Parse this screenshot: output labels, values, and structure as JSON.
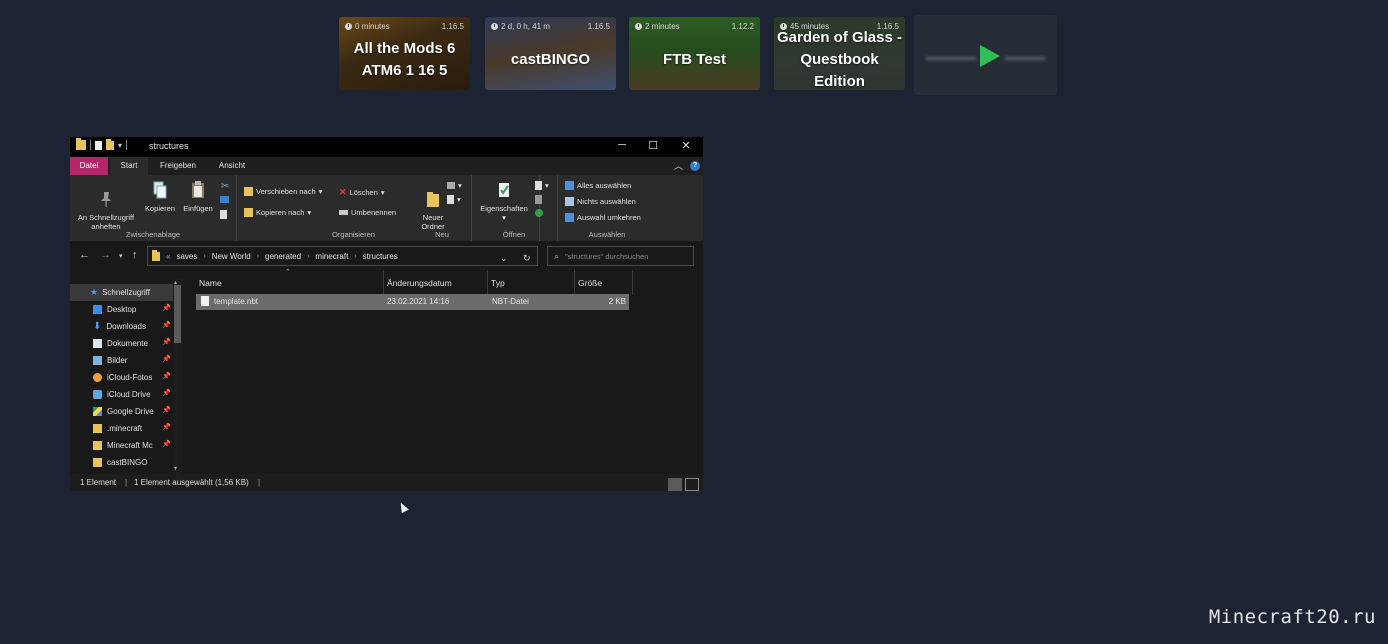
{
  "cards": [
    {
      "time": "0 minutes",
      "version": "1.16.5",
      "title": "All the Mods 6\nATM6 1 16 5"
    },
    {
      "time": "2 d, 0 h, 41 m",
      "version": "1.16.5",
      "title": "castBINGO"
    },
    {
      "time": "2 minutes",
      "version": "1.12.2",
      "title": "FTB Test"
    },
    {
      "time": "45 minutes",
      "version": "1.16.5",
      "title": "Garden of Glass -\nQuestbook Edition"
    }
  ],
  "explorer": {
    "title": "structures",
    "tabs": [
      "Datei",
      "Start",
      "Freigeben",
      "Ansicht"
    ],
    "ribbon": {
      "pin": "An Schnellzugriff\nanheften",
      "copy": "Kopieren",
      "paste": "Einfügen",
      "clipboard_group": "Zwischenablage",
      "move_to": "Verschieben nach",
      "copy_to": "Kopieren nach",
      "delete": "Löschen",
      "rename": "Umbenennen",
      "organize_group": "Organisieren",
      "new_folder": "Neuer\nOrdner",
      "new_group": "Neu",
      "properties": "Eigenschaften",
      "open_group": "Öffnen",
      "select_all": "Alles auswählen",
      "select_none": "Nichts auswählen",
      "invert_selection": "Auswahl umkehren",
      "select_group": "Auswählen"
    },
    "address": {
      "prefix": "«",
      "crumbs": [
        "saves",
        "New World",
        "generated",
        "minecraft",
        "structures"
      ],
      "search_placeholder": "\"structures\" durchsuchen"
    },
    "sidebar": [
      {
        "label": "Schnellzugriff",
        "icon": "star-icon",
        "pinned": false
      },
      {
        "label": "Desktop",
        "icon": "desktop-icon",
        "pinned": true
      },
      {
        "label": "Downloads",
        "icon": "download-icon",
        "pinned": true
      },
      {
        "label": "Dokumente",
        "icon": "document-icon",
        "pinned": true
      },
      {
        "label": "Bilder",
        "icon": "pictures-icon",
        "pinned": true
      },
      {
        "label": "iCloud-Fotos",
        "icon": "icloud-photos-icon",
        "pinned": true
      },
      {
        "label": "iCloud Drive",
        "icon": "icloud-drive-icon",
        "pinned": true
      },
      {
        "label": "Google Drive",
        "icon": "google-drive-icon",
        "pinned": true
      },
      {
        "label": ".minecraft",
        "icon": "folder-icon",
        "pinned": true
      },
      {
        "label": "Minecraft Mc",
        "icon": "folder-icon",
        "pinned": true
      },
      {
        "label": "castBINGO",
        "icon": "folder-icon",
        "pinned": false
      }
    ],
    "columns": [
      "Name",
      "Änderungsdatum",
      "Typ",
      "Größe"
    ],
    "files": [
      {
        "name": "template.nbt",
        "date": "23.02.2021 14:16",
        "type": "NBT-Datei",
        "size": "2 KB"
      }
    ],
    "status": {
      "count": "1 Element",
      "selected": "1 Element ausgewählt (1,56 KB)"
    }
  },
  "watermark": "Minecraft20.ru"
}
